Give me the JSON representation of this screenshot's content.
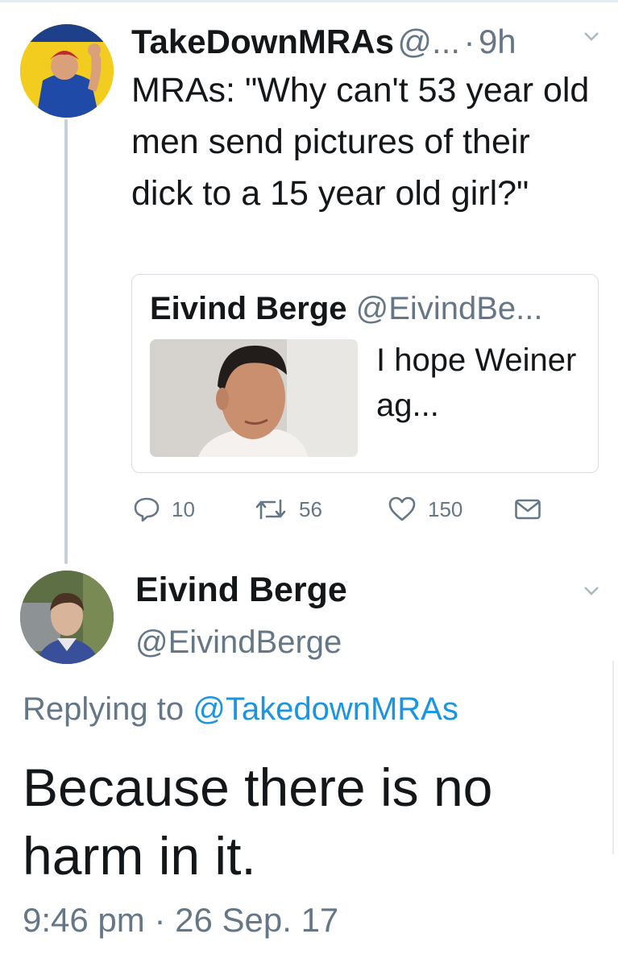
{
  "tweet": {
    "author_name": "TakeDownMRAs",
    "author_handle": "@...",
    "dot": "·",
    "time": "9h",
    "text": "MRAs: \"Why can't 53 year old men send pictures of their dick to a 15 year old girl?\"",
    "avatar_badge": "We Can Do It",
    "quoted": {
      "author_name": "Eivind Berge",
      "author_handle": "@EivindBe...",
      "text": "I hope Weiner ag..."
    },
    "actions": {
      "replies": "10",
      "retweets": "56",
      "likes": "150",
      "icons": [
        "reply-icon",
        "retweet-icon",
        "heart-icon",
        "envelope-icon"
      ]
    }
  },
  "reply": {
    "author_name": "Eivind Berge",
    "author_handle": "@EivindBerge",
    "replying_prefix": "Replying to",
    "replying_to": "@TakedownMRAs",
    "text": "Because there is no harm in it.",
    "timestamp": "9:46 pm",
    "dot": "·",
    "date": "26 Sep. 17"
  },
  "colors": {
    "text_primary": "#14171a",
    "text_secondary": "#657786",
    "link": "#1b95e0",
    "thread_line": "#c4cfd6",
    "card_border": "#d8dee3"
  }
}
